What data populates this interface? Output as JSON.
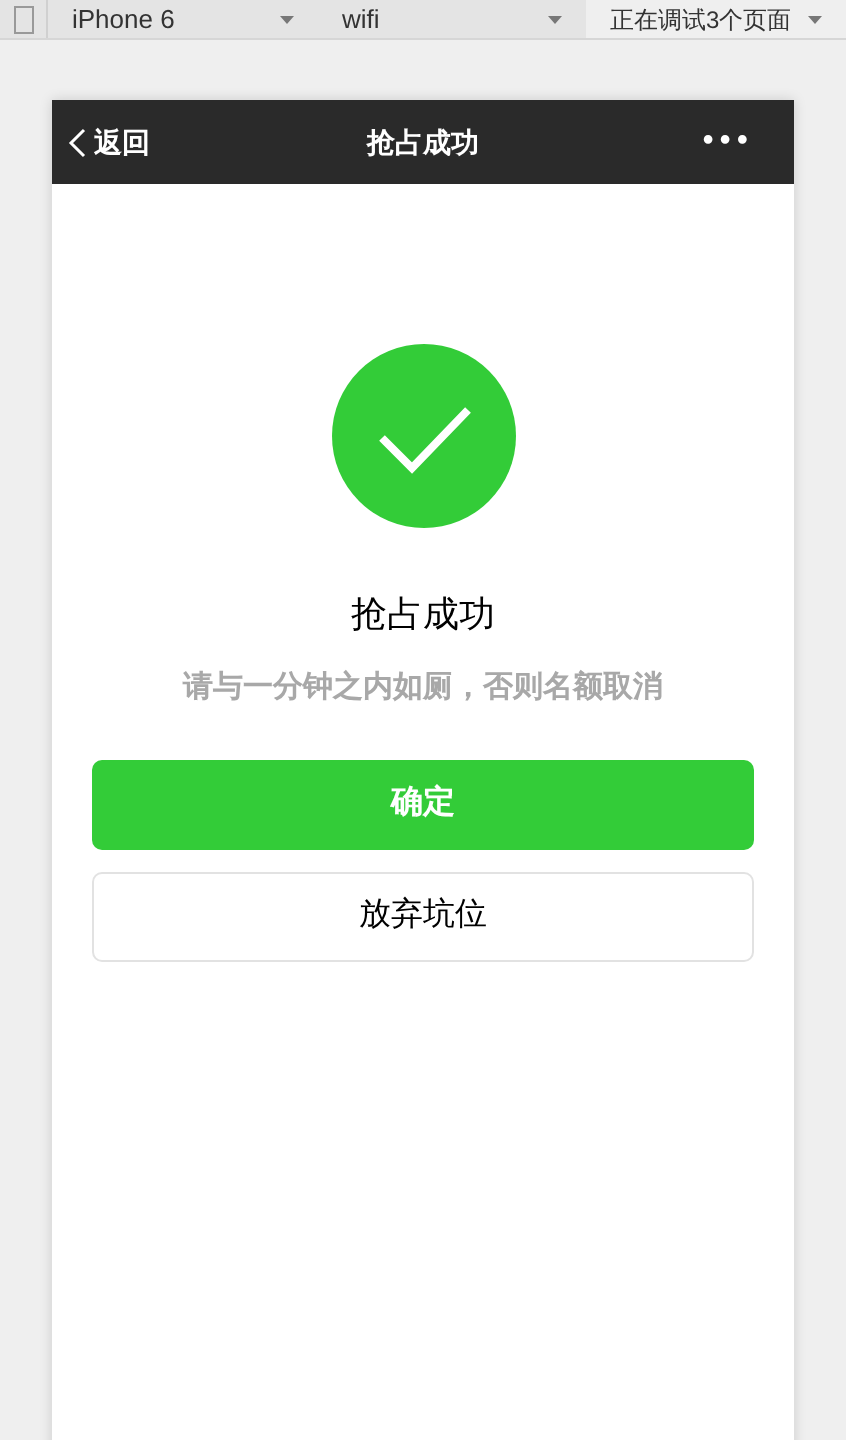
{
  "toolbar": {
    "dropdowns": [
      {
        "label": "iPhone 6"
      },
      {
        "label": "wifi"
      },
      {
        "label": "正在调试3个页面"
      }
    ]
  },
  "nav_bar": {
    "back": "返回",
    "title": "抢占成功",
    "more": "•••"
  },
  "result": {
    "title": "抢占成功",
    "message": "请与一分钟之内如厕，否则名额取消"
  },
  "buttons": [
    {
      "label": "确定",
      "kind": "primary"
    },
    {
      "label": "放弃坑位",
      "kind": "default"
    }
  ]
}
